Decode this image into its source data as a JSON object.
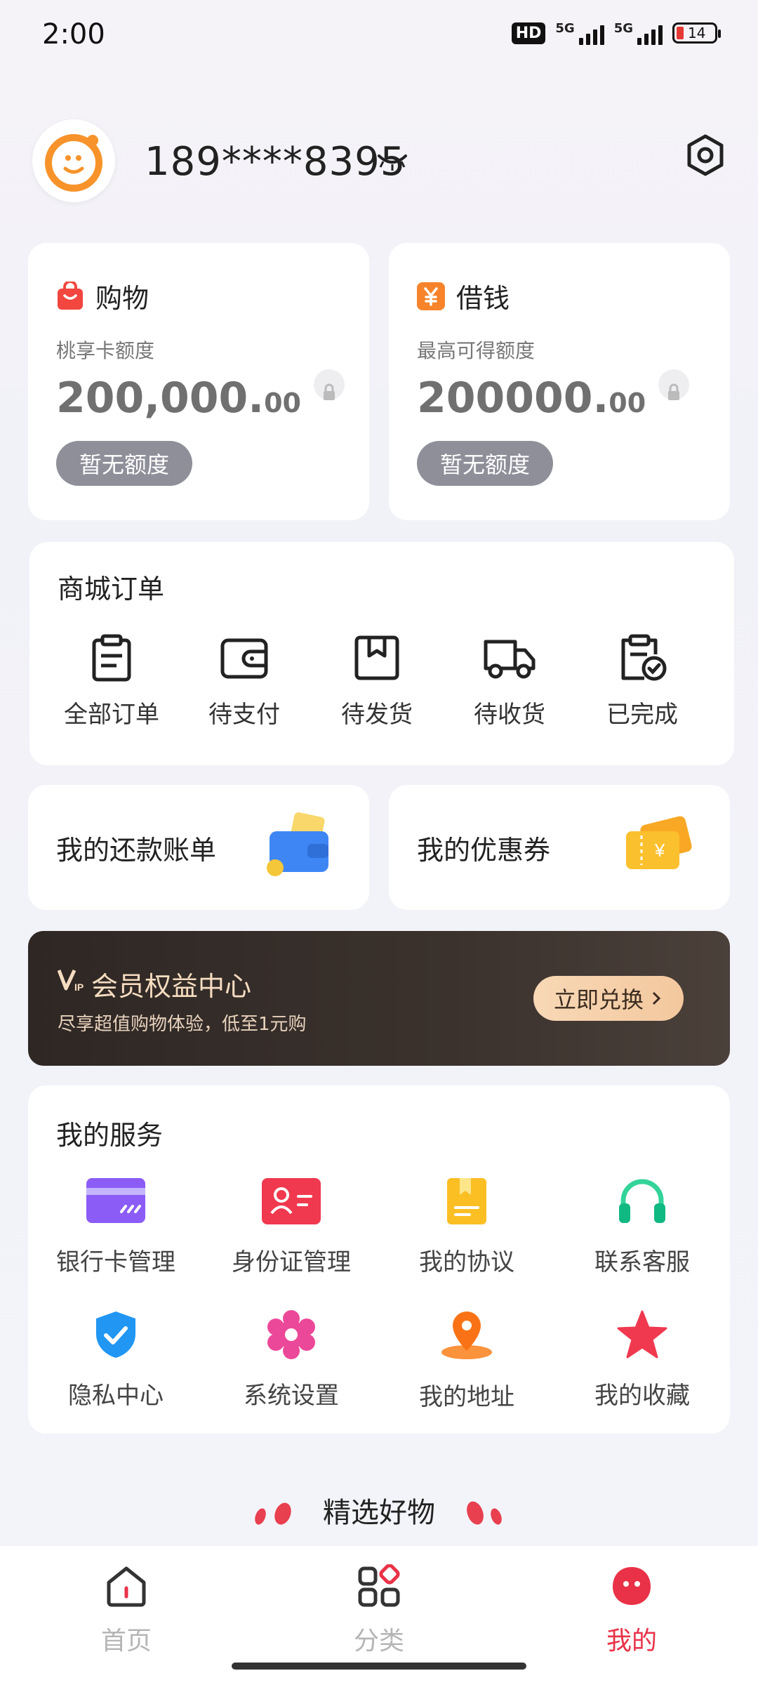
{
  "status_bar": {
    "time": "2:00",
    "hd": "HD",
    "network1": "5G",
    "network2": "5G",
    "battery": "14"
  },
  "profile": {
    "phone": "189****8395"
  },
  "credit": [
    {
      "title": "购物",
      "subtitle": "桃享卡额度",
      "amount_int": "200,000.",
      "amount_dec": "00",
      "button": "暂无额度",
      "icon": "shopping-bag-icon",
      "color": "#f2463f"
    },
    {
      "title": "借钱",
      "subtitle": "最高可得额度",
      "amount_int": "200000.",
      "amount_dec": "00",
      "button": "暂无额度",
      "icon": "yuan-icon",
      "color": "#f7832a"
    }
  ],
  "orders": {
    "title": "商城订单",
    "items": [
      {
        "label": "全部订单",
        "icon": "clipboard-icon"
      },
      {
        "label": "待支付",
        "icon": "wallet-icon"
      },
      {
        "label": "待发货",
        "icon": "box-icon"
      },
      {
        "label": "待收货",
        "icon": "truck-icon"
      },
      {
        "label": "已完成",
        "icon": "completed-icon"
      }
    ]
  },
  "promos": [
    {
      "label": "我的还款账单",
      "icon": "bill-wallet-icon"
    },
    {
      "label": "我的优惠券",
      "icon": "coupon-icon"
    }
  ],
  "vip": {
    "badge": "VIP",
    "title": "会员权益中心",
    "subtitle": "尽享超值购物体验，低至1元购",
    "button": "立即兑换"
  },
  "services": {
    "title": "我的服务",
    "items": [
      {
        "label": "银行卡管理",
        "icon": "bank-card-icon"
      },
      {
        "label": "身份证管理",
        "icon": "id-card-icon"
      },
      {
        "label": "我的协议",
        "icon": "agreement-icon"
      },
      {
        "label": "联系客服",
        "icon": "headset-icon"
      },
      {
        "label": "隐私中心",
        "icon": "shield-icon"
      },
      {
        "label": "系统设置",
        "icon": "settings-flower-icon"
      },
      {
        "label": "我的地址",
        "icon": "location-pin-icon"
      },
      {
        "label": "我的收藏",
        "icon": "star-icon"
      }
    ]
  },
  "featured": {
    "title": "精选好物"
  },
  "tabbar": [
    {
      "label": "首页",
      "icon": "home-icon"
    },
    {
      "label": "分类",
      "icon": "category-icon"
    },
    {
      "label": "我的",
      "icon": "mine-icon",
      "active": true
    }
  ],
  "colors": {
    "accent": "#e93248",
    "vip_bg": "#2e2724",
    "vip_btn": "#f6d3af",
    "disabled_btn": "#8e8f99"
  }
}
